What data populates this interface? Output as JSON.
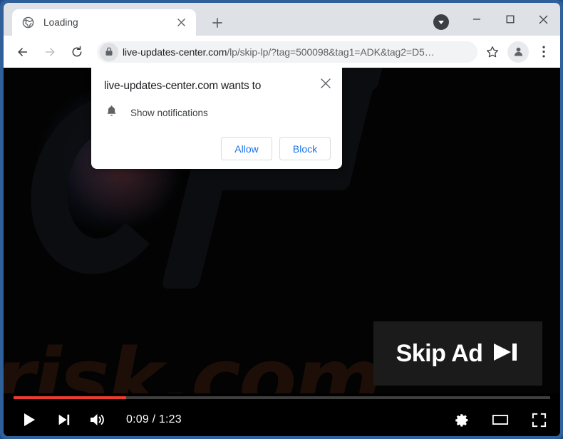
{
  "window": {
    "frame_color": "#2f6099",
    "controls": {
      "tab_search_label": "Tab search",
      "minimize_label": "Minimize",
      "maximize_label": "Maximize",
      "close_label": "Close"
    }
  },
  "tabstrip": {
    "tabs": [
      {
        "title": "Loading",
        "favicon": "globe-icon",
        "close_label": "Close tab"
      }
    ],
    "new_tab_label": "New tab"
  },
  "toolbar": {
    "back_label": "Back",
    "forward_label": "Forward",
    "reload_label": "Reload",
    "site_info_label": "View site information",
    "url_domain": "live-updates-center.com",
    "url_path": "/lp/skip-lp/?tag=500098&tag1=ADK&tag2=D5…",
    "url_full": "live-updates-center.com/lp/skip-lp/?tag=500098&tag1=ADK&tag2=D5…",
    "bookmark_label": "Bookmark this tab",
    "profile_label": "Profile",
    "menu_label": "Customize and control Google Chrome"
  },
  "dialog": {
    "title": "live-updates-center.com wants to",
    "permission_icon": "bell-icon",
    "permission_label": "Show notifications",
    "allow_label": "Allow",
    "block_label": "Block",
    "close_label": "Close",
    "accent_color": "#1a73e8"
  },
  "page": {
    "watermark_text": "risk.com",
    "skip_ad_label": "Skip Ad",
    "skip_ad_icon": "skip-next-icon",
    "skip_ad_bg": "#1b1b1b"
  },
  "player": {
    "play_label": "Play",
    "next_label": "Next",
    "volume_label": "Mute",
    "current_time": "0:09",
    "duration": "1:23",
    "time_display": "0:09 / 1:23",
    "progress_percent": 21,
    "progress_color": "#ed3c2f",
    "settings_label": "Settings",
    "theater_label": "Theater mode",
    "fullscreen_label": "Full screen"
  }
}
